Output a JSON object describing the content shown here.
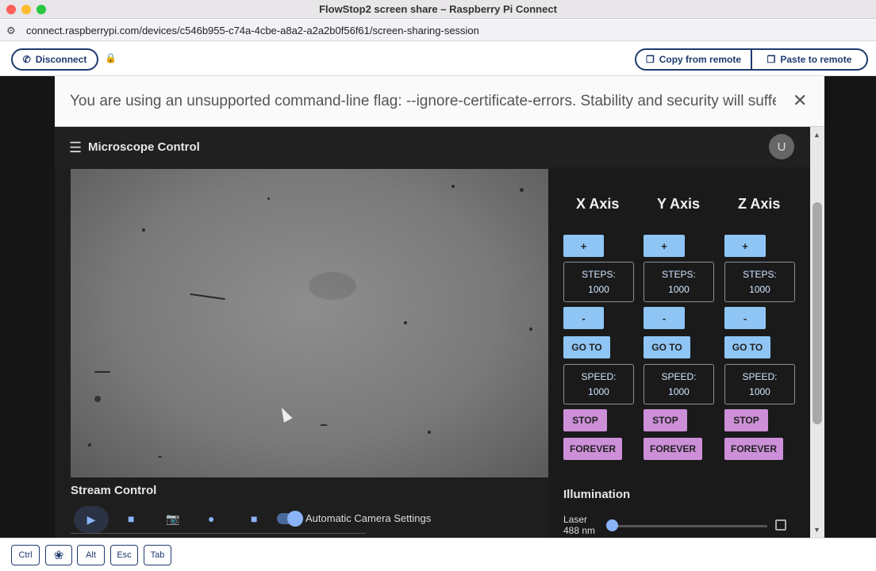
{
  "window": {
    "title": "FlowStop2 screen share – Raspberry Pi Connect"
  },
  "url": "connect.raspberrypi.com/devices/c546b955-c74a-4cbe-a8a2-a2a2b0f56f61/screen-sharing-session",
  "connect_toolbar": {
    "disconnect_label": "Disconnect",
    "copy_from_remote_label": "Copy from remote",
    "paste_to_remote_label": "Paste to remote"
  },
  "remote": {
    "warning_text": "You are using an unsupported command-line flag: --ignore-certificate-errors. Stability and security will suffer.",
    "close_glyph": "✕",
    "app_title": "Microscope Control",
    "avatar_initial": "U",
    "axes": [
      {
        "title": "X Axis",
        "plus": "+",
        "steps_label": "STEPS:",
        "steps_value": "1000",
        "minus": "-",
        "goto": "GO TO",
        "speed_label": "SPEED:",
        "speed_value": "1000",
        "stop": "STOP",
        "forever": "FOREVER"
      },
      {
        "title": "Y Axis",
        "plus": "+",
        "steps_label": "STEPS:",
        "steps_value": "1000",
        "minus": "-",
        "goto": "GO TO",
        "speed_label": "SPEED:",
        "speed_value": "1000",
        "stop": "STOP",
        "forever": "FOREVER"
      },
      {
        "title": "Z Axis",
        "plus": "+",
        "steps_label": "STEPS:",
        "steps_value": "1000",
        "minus": "-",
        "goto": "GO TO",
        "speed_label": "SPEED:",
        "speed_value": "1000",
        "stop": "STOP",
        "forever": "FOREVER"
      }
    ],
    "stream_control": {
      "title": "Stream Control",
      "auto_camera_label": "Automatic Camera Settings",
      "auto_camera_on": true
    },
    "illumination": {
      "title": "Illumination",
      "laser_label": "Laser",
      "laser_wavelength": "488 nm",
      "laser_level": 0,
      "laser_enabled": false
    }
  },
  "keys": [
    "Ctrl",
    "Alt",
    "Esc",
    "Tab"
  ],
  "colors": {
    "accent": "#1e3a6e",
    "axis_button": "#8ec5f4",
    "stop_button": "#cc8fd8",
    "stream_icon": "#8ab4f8"
  }
}
